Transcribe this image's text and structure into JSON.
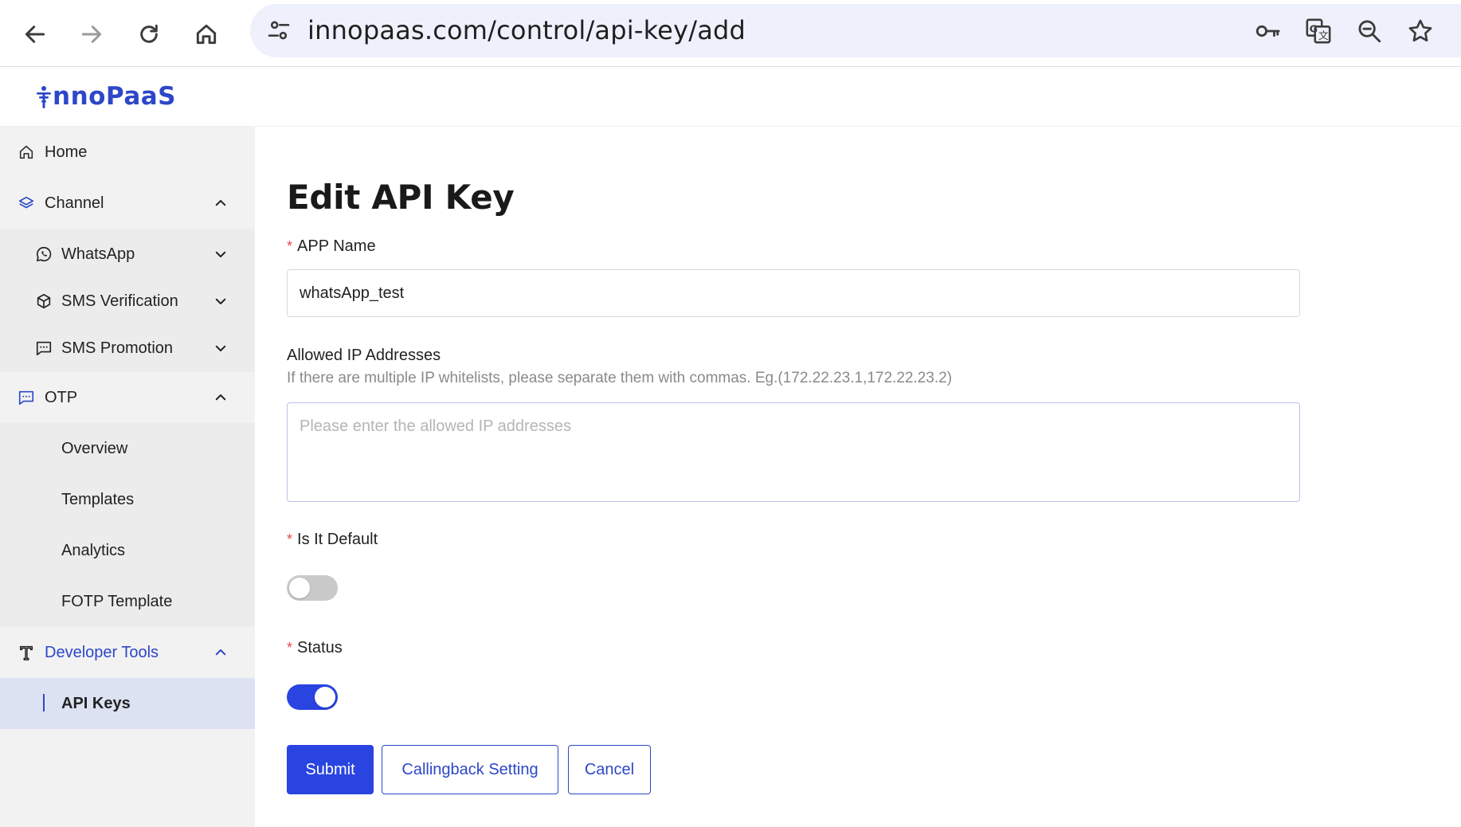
{
  "browser": {
    "url": "innopaas.com/control/api-key/add"
  },
  "app": {
    "logo_text": "nnoPaaS",
    "brand_color": "#2d47c8"
  },
  "sidebar": {
    "items": [
      {
        "label": "Home",
        "icon": "home-icon"
      },
      {
        "label": "Channel",
        "icon": "layers-icon",
        "expanded": true
      },
      {
        "label": "WhatsApp",
        "icon": "whatsapp-icon"
      },
      {
        "label": "SMS Verification",
        "icon": "cube-icon"
      },
      {
        "label": "SMS Promotion",
        "icon": "message-icon"
      },
      {
        "label": "OTP",
        "icon": "otp-message-icon",
        "expanded": true
      },
      {
        "label": "Overview"
      },
      {
        "label": "Templates"
      },
      {
        "label": "Analytics"
      },
      {
        "label": "FOTP Template"
      },
      {
        "label": "Developer Tools",
        "icon": "tools-icon",
        "expanded": true
      },
      {
        "label": "API Keys",
        "active": true
      }
    ]
  },
  "form": {
    "title": "Edit API Key",
    "app_name_label": "APP Name",
    "app_name_value": "whatsApp_test",
    "ip_label": "Allowed IP Addresses",
    "ip_hint": "If there are multiple IP whitelists, please separate them with commas. Eg.(172.22.23.1,172.22.23.2)",
    "ip_placeholder": "Please enter the allowed IP addresses",
    "default_label": "Is It Default",
    "default_on": false,
    "status_label": "Status",
    "status_on": true,
    "required_mark": "*",
    "submit_label": "Submit",
    "callback_label": "Callingback Setting",
    "cancel_label": "Cancel"
  },
  "colors": {
    "primary": "#2944e0",
    "required": "#e5484d",
    "toggle_off": "#c9c9c9"
  }
}
